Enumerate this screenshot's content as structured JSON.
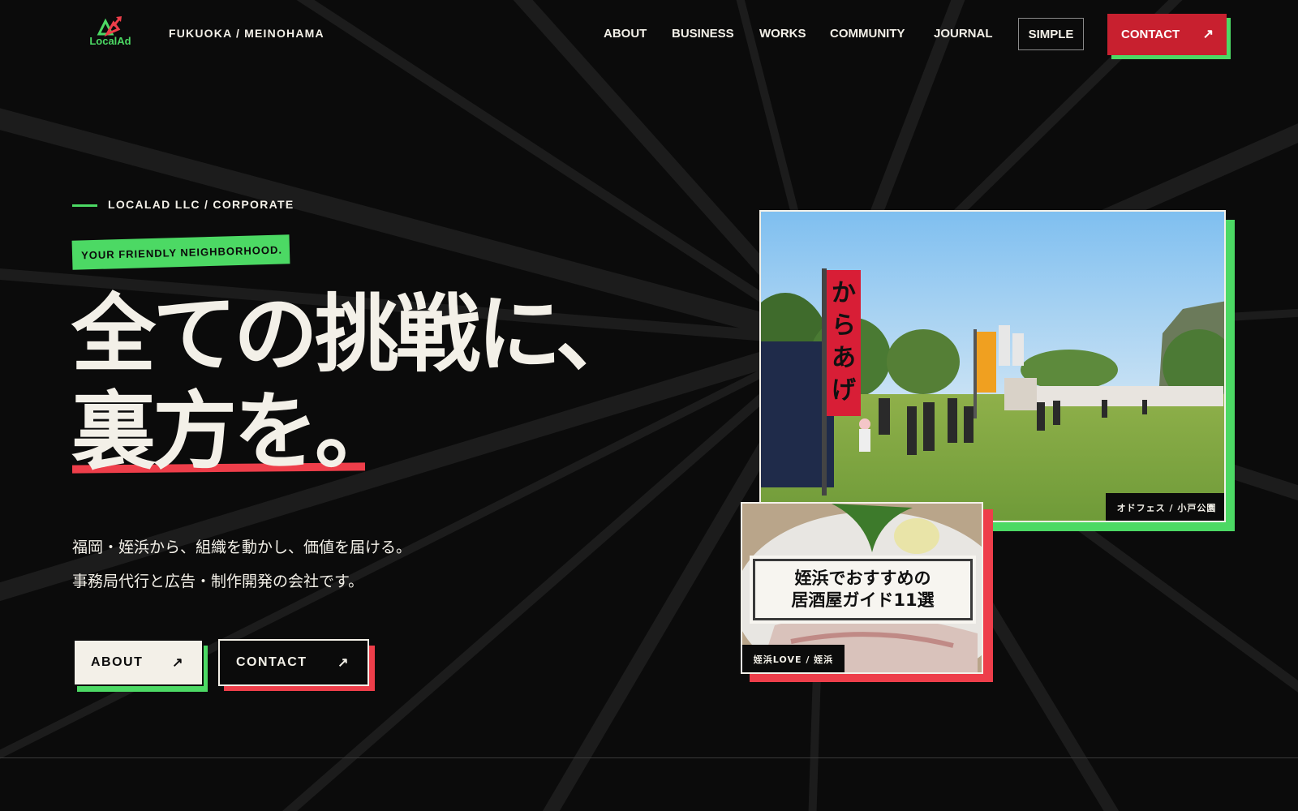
{
  "header": {
    "logo_text": "LocalAd",
    "location": "FUKUOKA / MEINOHAMA",
    "nav": [
      "ABOUT",
      "BUSINESS",
      "WORKS",
      "COMMUNITY",
      "JOURNAL"
    ],
    "simple_label": "SIMPLE",
    "contact_label": "CONTACT"
  },
  "hero": {
    "eyebrow": "LOCALAD LLC / CORPORATE",
    "tagline": "YOUR FRIENDLY NEIGHBORHOOD.",
    "headline_line1": "全ての挑戦に、",
    "headline_line2": "裏方を。",
    "lead_line1": "福岡・姪浜から、組織を動かし、価値を届ける。",
    "lead_line2": "事務局代行と広告・制作開発の会社です。",
    "about_button": "ABOUT",
    "contact_button": "CONTACT",
    "arrow_glyph": "↗"
  },
  "photos": {
    "main_caption": "オドフェス / 小戸公園",
    "main_flag_text": "からあげ",
    "sub_card_line1": "姪浜でおすすめの",
    "sub_card_line2": "居酒屋ガイド11選",
    "sub_caption": "姪浜LOVE / 姪浜"
  },
  "colors": {
    "background": "#0b0b0b",
    "accent_green": "#4cd964",
    "accent_red": "#ee3e4a",
    "contact_red": "#c8202f",
    "text": "#f3f0e8"
  }
}
